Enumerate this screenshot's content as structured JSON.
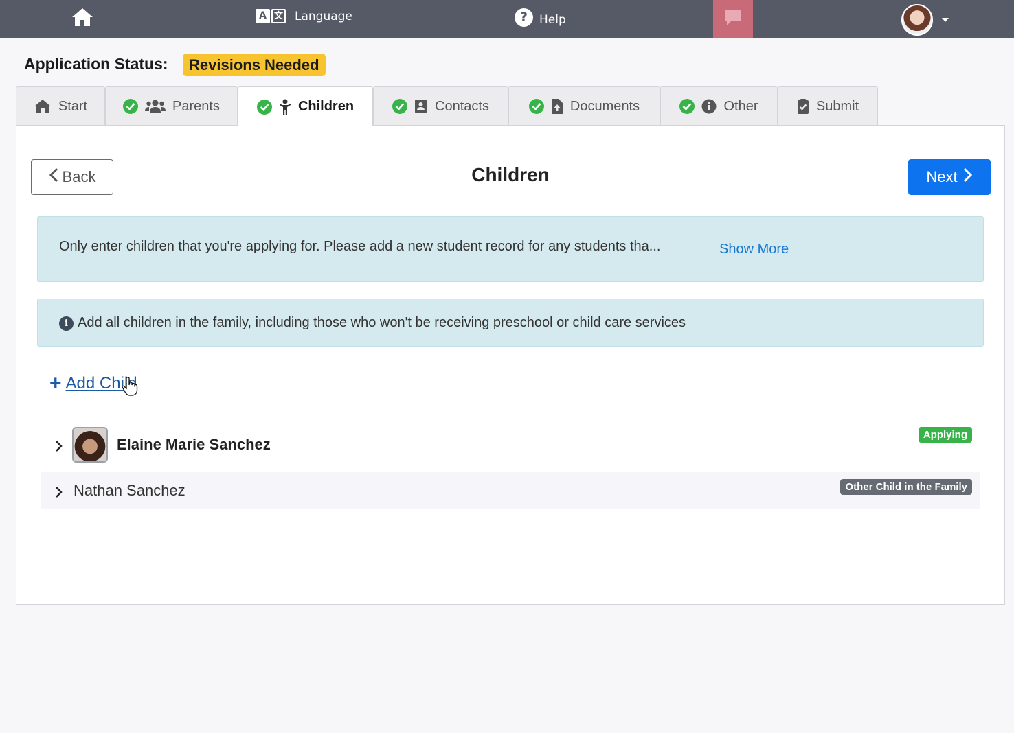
{
  "nav": {
    "home_icon": "home-icon",
    "language_label": "Language",
    "language_glyph_a": "A",
    "language_glyph_b": "文",
    "help_glyph": "?",
    "help_label": "Help",
    "chat_icon": "chat-icon",
    "avatar": "user-avatar"
  },
  "status": {
    "label": "Application Status:",
    "value": "Revisions Needed",
    "badge_color": "#f7c32e"
  },
  "tabs": [
    {
      "label": "Start",
      "icon": "home-icon",
      "complete": false
    },
    {
      "label": "Parents",
      "icon": "users-icon",
      "complete": true
    },
    {
      "label": "Children",
      "icon": "child-icon",
      "complete": true,
      "active": true
    },
    {
      "label": "Contacts",
      "icon": "address-book-icon",
      "complete": true
    },
    {
      "label": "Documents",
      "icon": "file-upload-icon",
      "complete": true
    },
    {
      "label": "Other",
      "icon": "info-icon",
      "complete": true
    },
    {
      "label": "Submit",
      "icon": "clipboard-check-icon",
      "complete": false
    }
  ],
  "page": {
    "title": "Children",
    "back_label": "Back",
    "next_label": "Next",
    "accent_color": "#0d73ef"
  },
  "alerts": {
    "notice_text": "Only enter children that you're applying for. Please add a new student record for any students tha...",
    "show_more": "Show More",
    "info_glyph": "i",
    "info_text": "Add all children in the family, including those who won't be receiving preschool or child care services"
  },
  "add_child": {
    "plus": "+",
    "label": "Add Child"
  },
  "children": [
    {
      "name": "Elaine Marie Sanchez",
      "badge": "Applying",
      "badge_color": "#37b34a",
      "has_photo": true
    },
    {
      "name": "Nathan Sanchez",
      "badge": "Other Child in the Family",
      "badge_color": "#666a72",
      "has_photo": false
    }
  ]
}
